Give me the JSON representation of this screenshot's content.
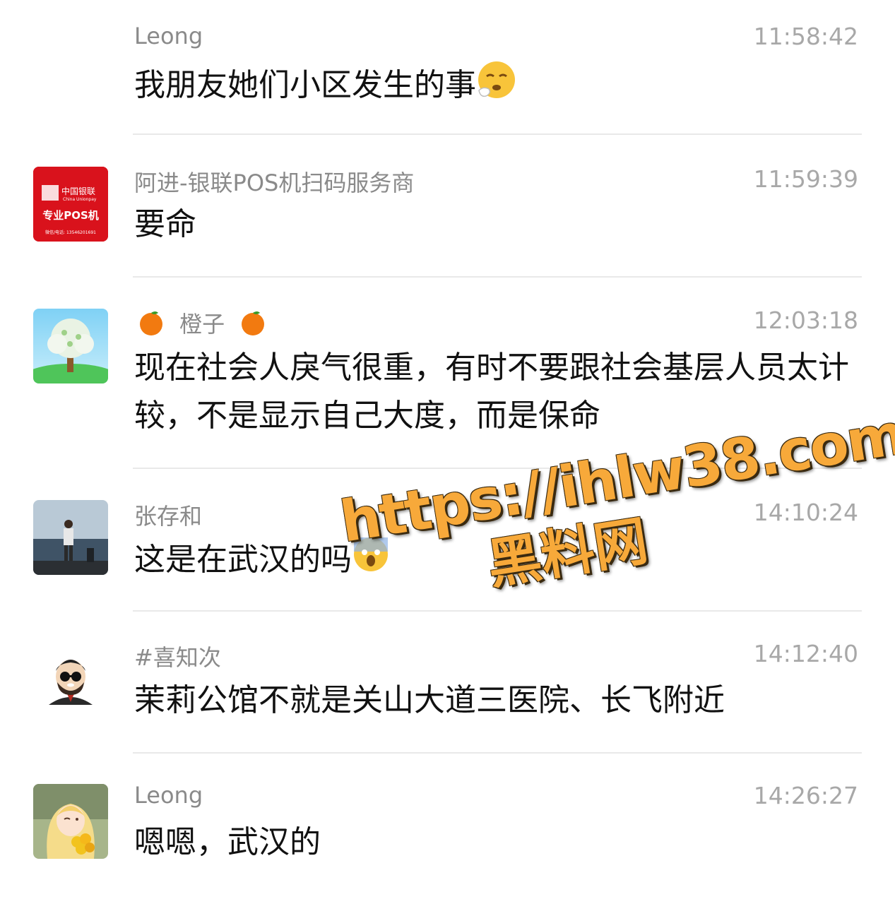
{
  "messages": [
    {
      "name": "Leong",
      "time": "11:58:42",
      "text": "我朋友她们小区发生的事",
      "emoji": "sneezing-face-emoji",
      "avatar": "none"
    },
    {
      "name": "阿进-银联POS机扫码服务商",
      "time": "11:59:39",
      "text": "要命",
      "avatar": "unionpay-pos-avatar",
      "avatar_text": {
        "brand_cn": "中国银联",
        "brand_en": "China Unionpay",
        "title": "专业POS机",
        "contact": "微信/电话: 13546201691"
      }
    },
    {
      "name": "橙子",
      "time": "12:03:18",
      "text": "现在社会人戾气很重，有时不要跟社会基层人员太计较，不是显示自己大度，而是保命",
      "avatar": "tree-avatar",
      "name_emoji": "orange-emoji"
    },
    {
      "name": "张存和",
      "time": "14:10:24",
      "text": "这是在武汉的吗",
      "emoji": "screaming-face-emoji",
      "avatar": "seaside-photo-avatar"
    },
    {
      "name": "#喜知次",
      "time": "14:12:40",
      "text": "茉莉公馆不就是关山大道三医院、长飞附近",
      "avatar": "bearded-man-cartoon-avatar"
    },
    {
      "name": "Leong",
      "time": "14:26:27",
      "text": "嗯嗯，武汉的",
      "avatar": "girl-with-flowers-avatar"
    }
  ],
  "watermark": {
    "url": "https://ihlw38.com",
    "label": "黑料网"
  },
  "colors": {
    "name": "#8a8a8a",
    "time": "#a8a8a8",
    "text": "#111111",
    "divider": "#e9e9e9",
    "watermark": "#f7a93a"
  }
}
